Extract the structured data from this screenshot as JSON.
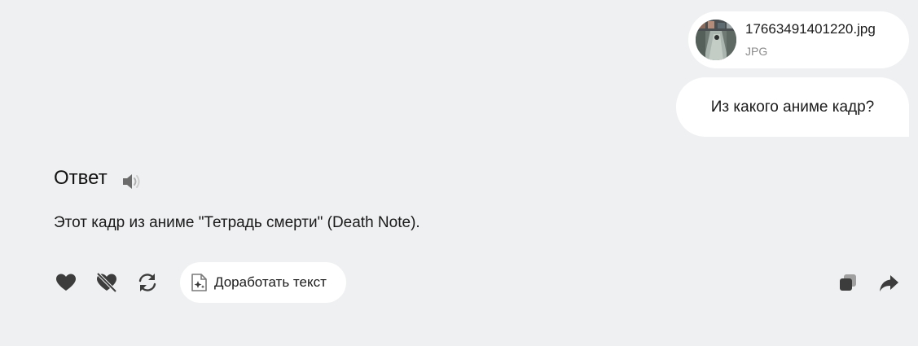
{
  "attachment": {
    "file_name": "17663491401220.jpg",
    "file_type": "JPG"
  },
  "user_message": {
    "text": "Из какого аниме кадр?"
  },
  "answer": {
    "title": "Ответ",
    "text": "Этот кадр из аниме \"Тетрадь смерти\" (Death Note)."
  },
  "actions": {
    "improve_label": "Доработать текст",
    "icons": [
      "heart-icon",
      "heart-off-icon",
      "refresh-icon",
      "copy-icon",
      "share-icon",
      "speaker-icon",
      "document-sparkle-icon"
    ]
  },
  "colors": {
    "background": "#eff0f2",
    "bubble": "#ffffff",
    "icon": "#3c3c3c",
    "muted_text": "#8a8a8a"
  }
}
